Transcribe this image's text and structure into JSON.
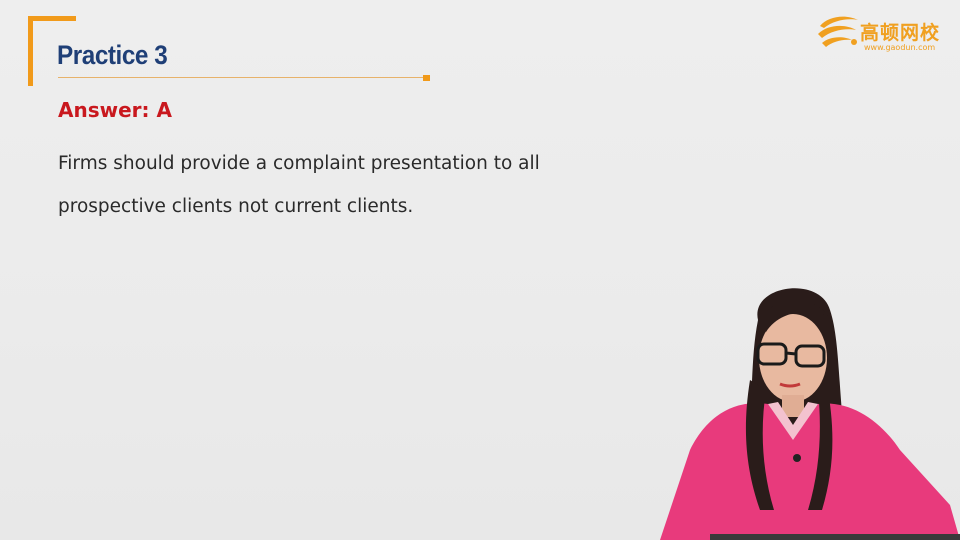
{
  "slide": {
    "title": "Practice 3",
    "answer": "Answer: A",
    "body_lines": [
      "Firms should provide a complaint presentation to all",
      "prospective clients not current clients."
    ]
  },
  "logo": {
    "chinese_name": "高顿网校",
    "url": "www.gaodun.com",
    "mark_icon": "gaodun-wave-logo-icon"
  },
  "presenter": {
    "icon": "presenter-video-person"
  },
  "colors": {
    "accent_orange": "#f19a1a",
    "title_blue": "#1f3f77",
    "answer_red": "#c9181e",
    "presenter_shirt": "#e83a7c"
  }
}
